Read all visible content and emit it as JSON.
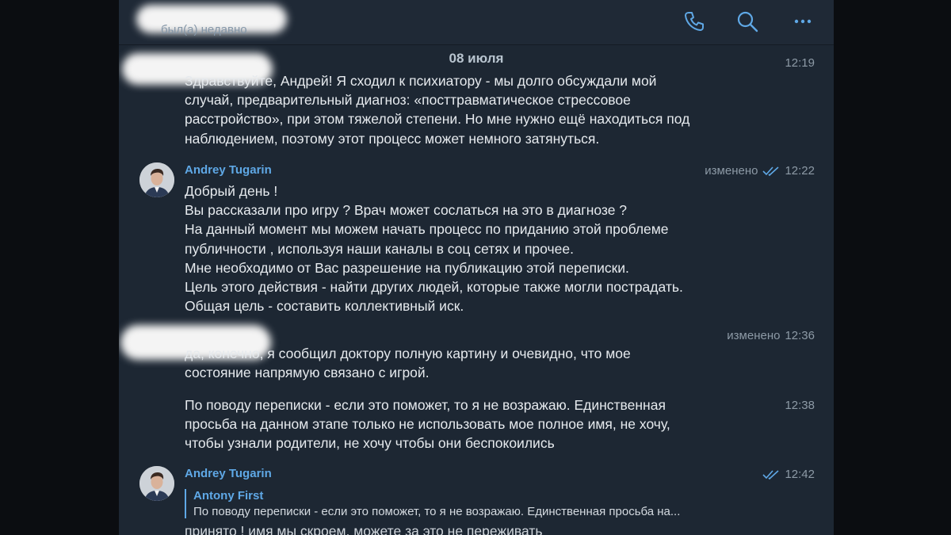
{
  "header": {
    "status": "был(а) недавно",
    "icons": [
      "phone-icon",
      "search-icon",
      "more-icon"
    ],
    "accent": "#5fa8e6"
  },
  "date_chip": "08 июля",
  "messages": [
    {
      "sender": "",
      "time": "12:19",
      "text": "Здравствуйте, Андрей! Я сходил к психиатору - мы долго обсуждали мой\nслучай, предварительный диагноз: «посттравматическое стрессовое\nрасстройство», при этом тяжелой степени. Но мне нужно ещё находиться под\nнаблюдением, поэтому этот процесс может немного затянуться."
    },
    {
      "sender": "Andrey Tugarin",
      "edited": "изменено",
      "time": "12:22",
      "text": "Добрый день !\nВы рассказали про игру ? Врач может сослаться на это в диагнозе ?\nНа данный момент мы можем начать процесс по приданию этой проблеме\nпубличности , используя наши каналы в соц сетях и прочее.\nМне необходимо от Вас разрешение на публикацию этой переписки.\nЦель этого действия - найти других людей, которые также могли пострадать.\nОбщая цель - составить коллективный иск."
    },
    {
      "sender": "",
      "edited": "изменено",
      "time": "12:36",
      "text": "да, конечно, я сообщил доктору полную картину и очевидно, что мое\nсостояние напрямую связано с игрой."
    },
    {
      "sender": "",
      "time": "12:38",
      "text": "По поводу переписки - если это поможет, то я не возражаю. Единственная\nпросьба на данном этапе только не использовать мое полное имя, не хочу,\nчтобы узнали родители, не хочу чтобы они беспокоились"
    },
    {
      "sender": "Andrey Tugarin",
      "time": "12:42",
      "reply_name": "Antony First",
      "reply_text": "По поводу переписки - если это поможет, то я не возражаю. Единственная просьба на...",
      "text": "принято ! имя мы скроем, можете за это не переживать"
    }
  ]
}
